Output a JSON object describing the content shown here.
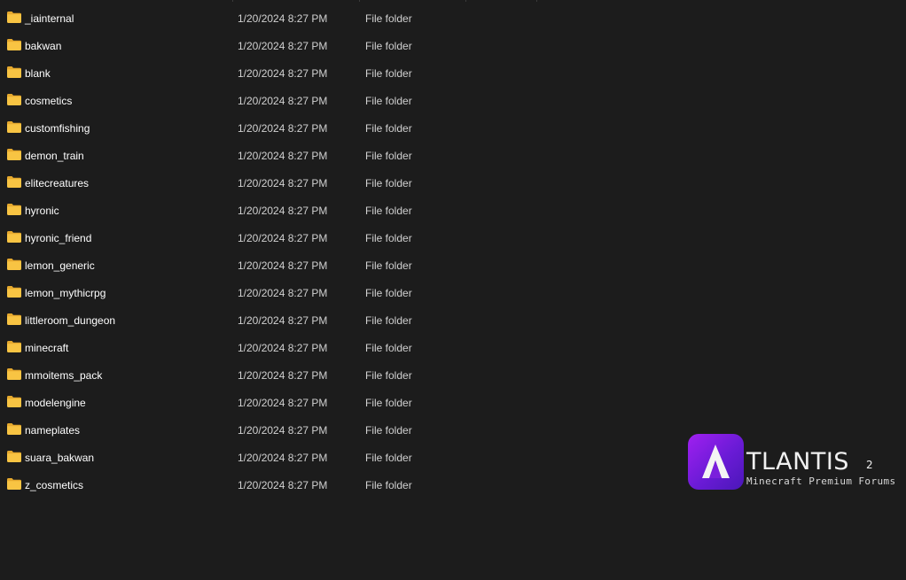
{
  "explorer": {
    "files": [
      {
        "name": "_iainternal",
        "date": "1/20/2024 8:27 PM",
        "type": "File folder"
      },
      {
        "name": "bakwan",
        "date": "1/20/2024 8:27 PM",
        "type": "File folder"
      },
      {
        "name": "blank",
        "date": "1/20/2024 8:27 PM",
        "type": "File folder"
      },
      {
        "name": "cosmetics",
        "date": "1/20/2024 8:27 PM",
        "type": "File folder"
      },
      {
        "name": "customfishing",
        "date": "1/20/2024 8:27 PM",
        "type": "File folder"
      },
      {
        "name": "demon_train",
        "date": "1/20/2024 8:27 PM",
        "type": "File folder"
      },
      {
        "name": "elitecreatures",
        "date": "1/20/2024 8:27 PM",
        "type": "File folder"
      },
      {
        "name": "hyronic",
        "date": "1/20/2024 8:27 PM",
        "type": "File folder"
      },
      {
        "name": "hyronic_friend",
        "date": "1/20/2024 8:27 PM",
        "type": "File folder"
      },
      {
        "name": "lemon_generic",
        "date": "1/20/2024 8:27 PM",
        "type": "File folder"
      },
      {
        "name": "lemon_mythicrpg",
        "date": "1/20/2024 8:27 PM",
        "type": "File folder"
      },
      {
        "name": "littleroom_dungeon",
        "date": "1/20/2024 8:27 PM",
        "type": "File folder"
      },
      {
        "name": "minecraft",
        "date": "1/20/2024 8:27 PM",
        "type": "File folder"
      },
      {
        "name": "mmoitems_pack",
        "date": "1/20/2024 8:27 PM",
        "type": "File folder"
      },
      {
        "name": "modelengine",
        "date": "1/20/2024 8:27 PM",
        "type": "File folder"
      },
      {
        "name": "nameplates",
        "date": "1/20/2024 8:27 PM",
        "type": "File folder"
      },
      {
        "name": "suara_bakwan",
        "date": "1/20/2024 8:27 PM",
        "type": "File folder"
      },
      {
        "name": "z_cosmetics",
        "date": "1/20/2024 8:27 PM",
        "type": "File folder"
      }
    ]
  },
  "watermark": {
    "title": "TLANTIS",
    "superscript": "2",
    "subtitle": "Minecraft Premium Forums"
  },
  "colors": {
    "background": "#1c1c1c",
    "folder_yellow": "#f8c443",
    "folder_yellow_back": "#e6a92e",
    "logo_purple": "#8a1ee8"
  },
  "icons": {
    "folder": "folder-icon",
    "logo": "atlantis-logo-icon"
  }
}
